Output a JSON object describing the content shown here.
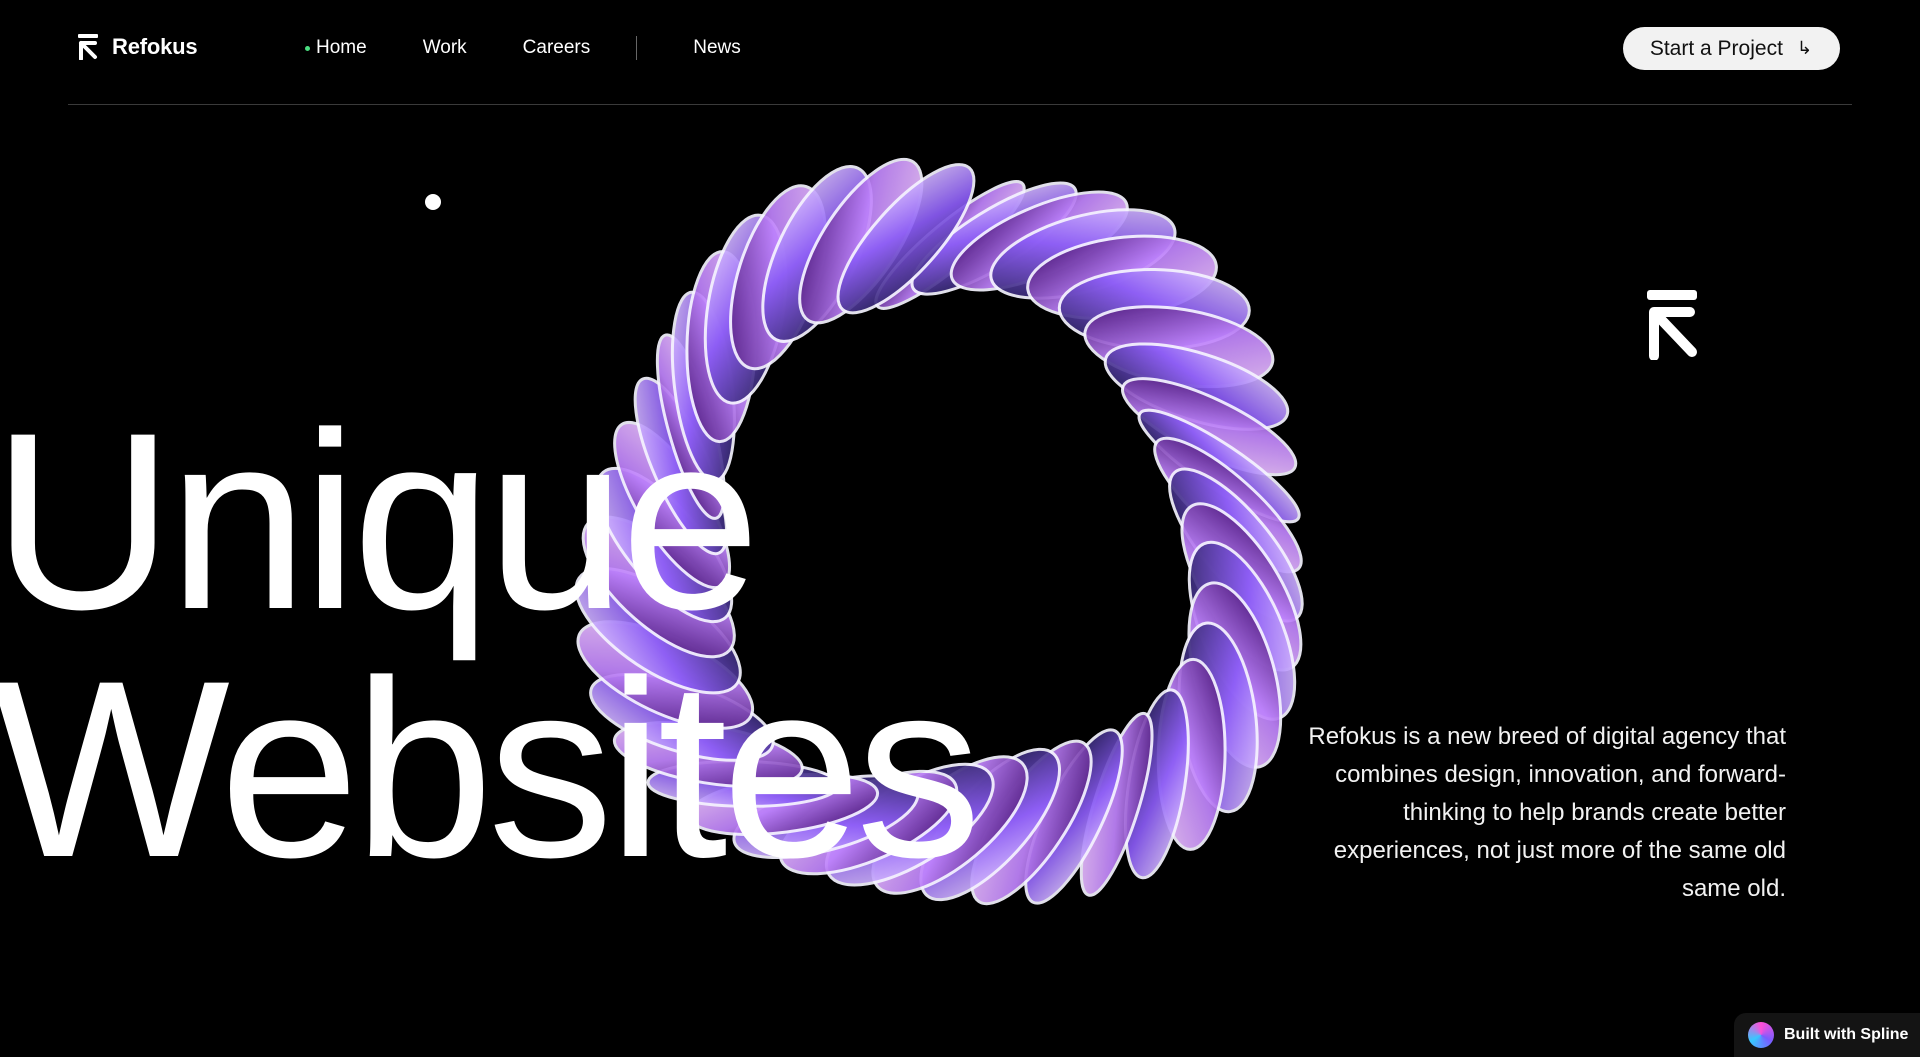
{
  "brand": {
    "name": "Refokus",
    "logo_icon": "refokus-arrow-icon"
  },
  "colors": {
    "background": "#000000",
    "active_dot": "#4ade80",
    "ring_violet": "#8b5cf6",
    "ring_pink": "#e879f9"
  },
  "nav": {
    "items": [
      {
        "label": "Home",
        "active": true
      },
      {
        "label": "Work",
        "active": false
      },
      {
        "label": "Careers",
        "active": false
      },
      {
        "label": "News",
        "active": false
      }
    ]
  },
  "cta": {
    "label": "Start a Project",
    "icon": "arrow-return-icon",
    "icon_glyph": "↳"
  },
  "hero": {
    "headline_line1": "Unique",
    "headline_line2": "Websites",
    "description": "Refokus is a new breed of digital agency that combines design, innovation, and forward-thinking to help brands create better experiences, not just more of the same old same old."
  },
  "badge": {
    "label": "Built with Spline"
  }
}
